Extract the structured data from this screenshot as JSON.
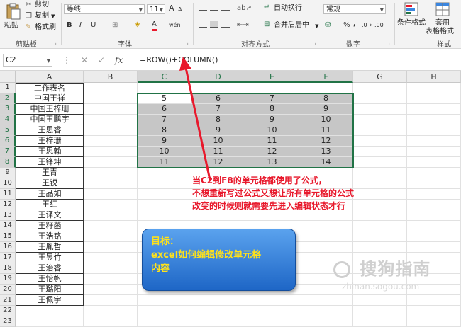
{
  "ribbon": {
    "clipboard": {
      "paste": "粘贴",
      "cut": "剪切",
      "copy": "复制",
      "format_painter": "格式刷",
      "group": "剪贴板"
    },
    "font": {
      "name": "等线",
      "size": "11",
      "grow": "A",
      "shrink": "A",
      "bold": "B",
      "italic": "I",
      "underline": "U",
      "font_color": "A",
      "phonetic": "wén",
      "group": "字体"
    },
    "alignment": {
      "wrap_text": "自动换行",
      "merge_center": "合并后居中",
      "group": "对齐方式"
    },
    "number": {
      "format": "常规",
      "percent": "%",
      "comma": ",",
      "group": "数字"
    },
    "styles": {
      "conditional": "条件格式",
      "table_format_1": "套用",
      "table_format_2": "表格格式",
      "group": "样式"
    }
  },
  "formula_bar": {
    "name_box": "C2",
    "fx": "fx",
    "formula": "=ROW()+COLUMN()"
  },
  "columns": [
    "A",
    "B",
    "C",
    "D",
    "E",
    "F",
    "G",
    "H"
  ],
  "rows": [
    "1",
    "2",
    "3",
    "4",
    "5",
    "6",
    "7",
    "8",
    "9",
    "10",
    "11",
    "12",
    "13",
    "14",
    "15",
    "16",
    "17",
    "18",
    "19",
    "20",
    "21",
    "22",
    "23"
  ],
  "col_a": [
    "工作表名",
    "中国王祥",
    "中国王梓珊",
    "中国王鹏宇",
    "王思睿",
    "王梓珊",
    "王思翰",
    "王锋坤",
    "王青",
    "王锐",
    "王品如",
    "王红",
    "王译文",
    "王籽菡",
    "王浩铭",
    "王胤哲",
    "王昱竹",
    "王治睿",
    "王怡帆",
    "王璐阳",
    "王佩宇"
  ],
  "values": [
    [
      5,
      6,
      7,
      8
    ],
    [
      6,
      7,
      8,
      9
    ],
    [
      7,
      8,
      9,
      10
    ],
    [
      8,
      9,
      10,
      11
    ],
    [
      9,
      10,
      11,
      12
    ],
    [
      10,
      11,
      12,
      13
    ],
    [
      11,
      12,
      13,
      14
    ]
  ],
  "annotation": {
    "line1": "当C2到F8的单元格都使用了公式，",
    "line2": "不想重新写过公式又想让所有单元格的公式",
    "line3": "改变的时候则就需要先进入编辑状态才行"
  },
  "goal": {
    "line1": "目标：",
    "line2": "excel如何编辑修改单元格",
    "line3": "内容"
  },
  "watermark": {
    "main": "搜狗指南",
    "sub": "zhinan.sogou.com"
  },
  "colors": {
    "accent": "#217346",
    "annotation": "#e8192c",
    "goal_text": "#ffe21a",
    "goal_bg": "#3b86df"
  }
}
